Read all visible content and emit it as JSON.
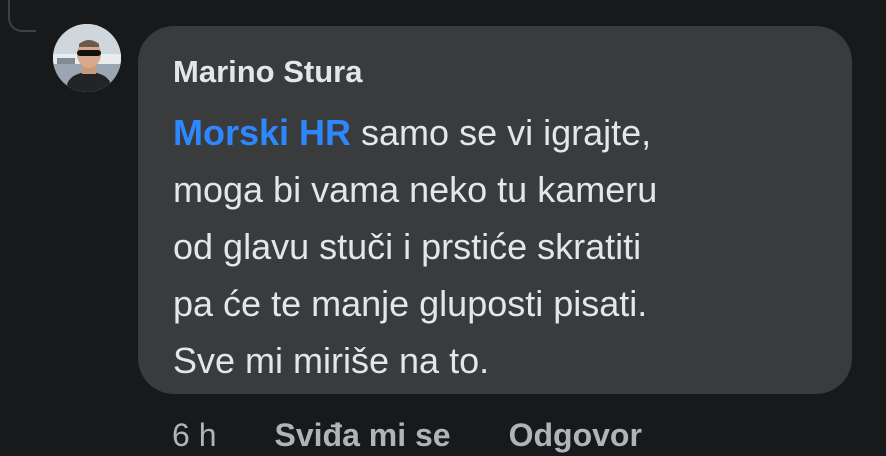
{
  "comment": {
    "author": "Marino Stura",
    "avatar_icon": "user-avatar-photo",
    "mention": "Morski HR",
    "lines": [
      " samo se vi igrajte,",
      "moga bi vama neko tu kameru",
      "od glavu stuči i prstiće skratiti",
      "pa će te manje gluposti pisati.",
      "Sve mi miriše na to."
    ],
    "time": "6 h",
    "like_label": "Sviđa mi se",
    "reply_label": "Odgovor"
  },
  "colors": {
    "background": "#18191a",
    "bubble": "#3a3b3c",
    "text": "#e4e6eb",
    "mention": "#2d88ff",
    "secondary_text": "#b0b3b8"
  }
}
